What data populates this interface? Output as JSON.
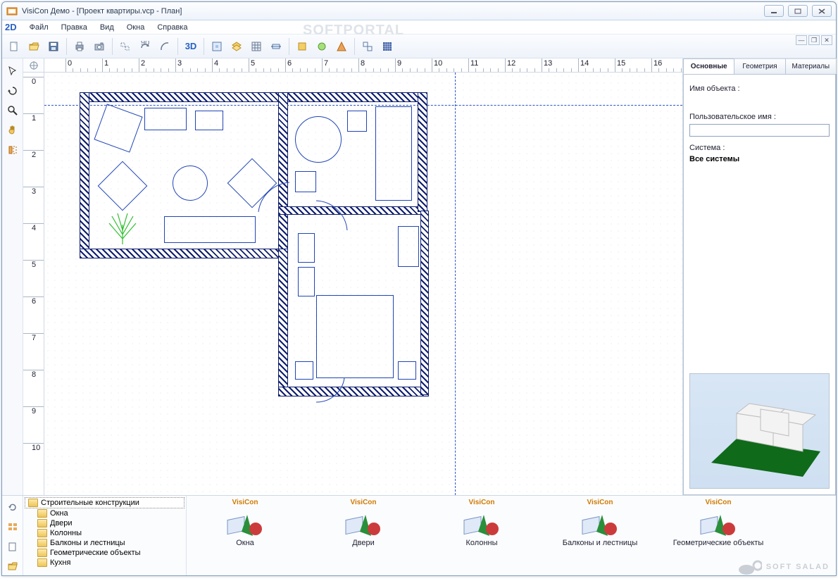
{
  "window": {
    "title": "VisiCon Демо - [Проект квартиры.vcp - План]"
  },
  "mode_label": "2D",
  "menu": {
    "file": "Файл",
    "edit": "Правка",
    "view": "Вид",
    "windows": "Окна",
    "help": "Справка"
  },
  "toolbar": {
    "new": "new-file",
    "open": "open-file",
    "save": "save-file",
    "print": "print",
    "camera": "camera",
    "align": "align",
    "rotate90": "rotate-90",
    "arc": "arc",
    "mode3d": "3D",
    "room": "room",
    "layers": "layers",
    "grid": "grid",
    "stretch": "stretch",
    "el1": "element-1",
    "el2": "element-2",
    "el3": "element-3",
    "group": "group",
    "hatch": "hatch-grid"
  },
  "left_tools": [
    "select",
    "rotate",
    "zoom",
    "pan",
    "mirror"
  ],
  "ruler": {
    "h_ticks": [
      0,
      1,
      2,
      3,
      4,
      5,
      6,
      7,
      8,
      9,
      10,
      11,
      12,
      13,
      14,
      15,
      16
    ],
    "v_ticks": [
      0,
      1,
      2,
      3,
      4,
      5,
      6,
      7,
      8,
      9,
      10
    ]
  },
  "right": {
    "tabs": {
      "basic": "Основные",
      "geometry": "Геометрия",
      "materials": "Материалы"
    },
    "name_label": "Имя объекта :",
    "name_value": "",
    "user_name_label": "Пользовательское имя :",
    "user_name_value": "",
    "system_label": "Система :",
    "system_value": "Все системы"
  },
  "tree": {
    "root": "Строительные конструкции",
    "children": [
      "Окна",
      "Двери",
      "Колонны",
      "Балконы и лестницы",
      "Геометрические объекты",
      "Кухня"
    ]
  },
  "gallery_brand": "VisiCon",
  "gallery": [
    "Окна",
    "Двери",
    "Колонны",
    "Балконы и лестницы",
    "Геометрические объекты"
  ],
  "watermark_top": "SOFTPORTAL",
  "watermark_bottom": "SOFT SALAD"
}
